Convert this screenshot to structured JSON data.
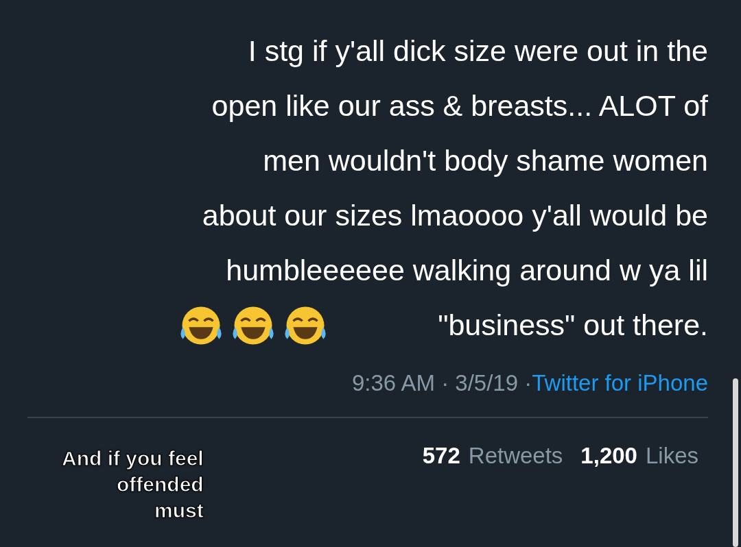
{
  "tweet": {
    "lines": [
      "I stg if y'all dick size were out in the",
      "open like our ass & breasts... ALOT of",
      "men wouldn't body shame women",
      "about our sizes lmaoooo y'all would be",
      "humbleeeeee walking around w ya lil",
      "\"business\" out there."
    ],
    "meta": "9:36 AM · 3/5/19 · ",
    "source": "Twitter for iPhone",
    "retweets": "572",
    "retweets_label": "Retweets",
    "likes": "1,200",
    "likes_label": "Likes"
  },
  "caption": [
    "And if you feel",
    "offended",
    "must"
  ]
}
